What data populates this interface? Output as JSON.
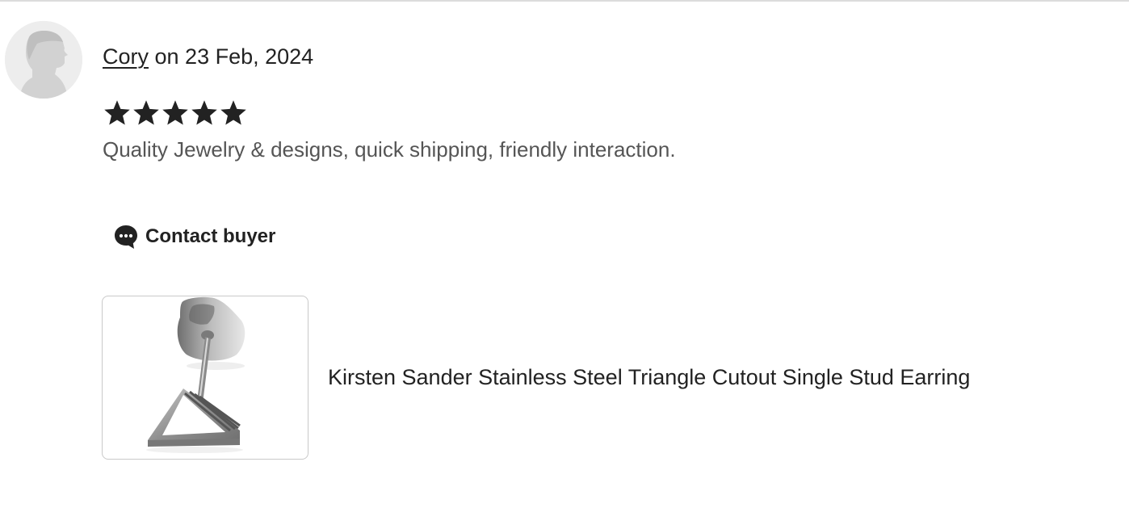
{
  "review": {
    "reviewer_name": "Cory",
    "date_text": " on 23 Feb, 2024",
    "rating": 5,
    "rating_max": 5,
    "text": "Quality Jewelry & designs, quick shipping, friendly interaction."
  },
  "actions": {
    "contact_label": "Contact buyer"
  },
  "product": {
    "title": "Kirsten Sander Stainless Steel Triangle Cutout Single Stud Earring"
  },
  "icons": {
    "avatar": "default-user-silhouette-icon",
    "star": "star-filled-icon",
    "contact": "chat-bubble-icon"
  },
  "colors": {
    "text": "#222222",
    "secondary_text": "#555555",
    "divider": "#dcdcdc",
    "avatar_bg": "#ededed"
  }
}
